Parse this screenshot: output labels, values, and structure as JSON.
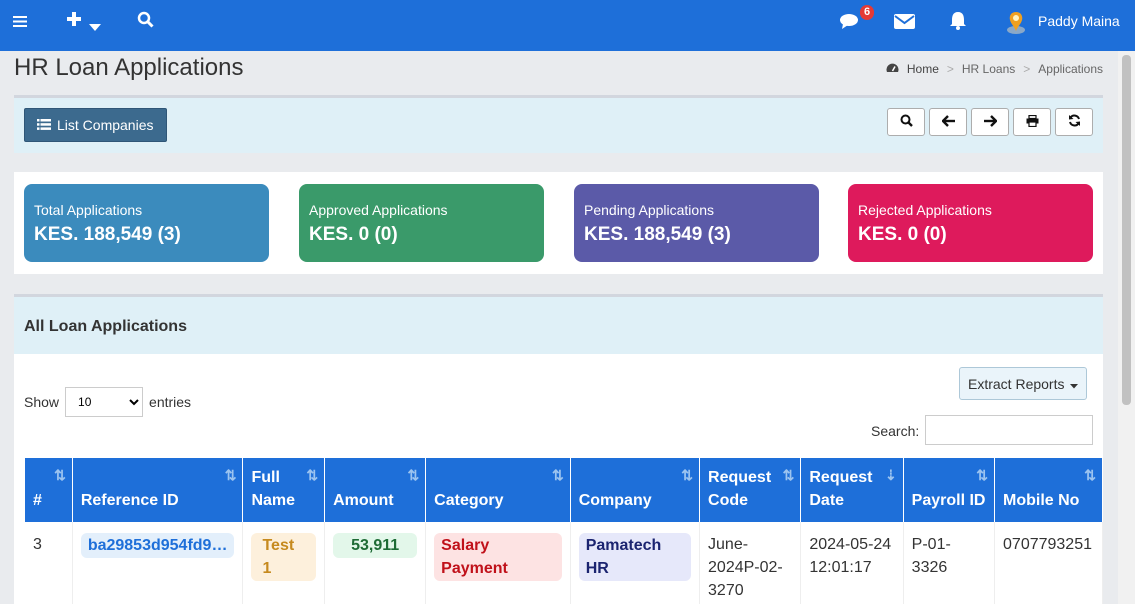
{
  "header": {
    "message_badge": "6",
    "user_name": "Paddy Maina",
    "icons": [
      "menu-icon",
      "plus-icon",
      "caret-down-icon",
      "search-icon",
      "comments-icon",
      "envelope-icon",
      "bell-icon",
      "user-avatar"
    ]
  },
  "page": {
    "title": "HR Loan Applications",
    "breadcrumb": [
      "Home",
      "HR Loans",
      "Applications"
    ]
  },
  "toolbar": {
    "list_companies": "List Companies",
    "tools": [
      "search-icon",
      "arrow-left-icon",
      "arrow-right-icon",
      "print-icon",
      "refresh-icon"
    ]
  },
  "stats": [
    {
      "label": "Total Applications",
      "value": "KES. 188,549 (3)",
      "color": "#3b8bbd"
    },
    {
      "label": "Approved Applications",
      "value": "KES. 0 (0)",
      "color": "#3a9a6a"
    },
    {
      "label": "Pending Applications",
      "value": "KES. 188,549 (3)",
      "color": "#5b5aa8"
    },
    {
      "label": "Rejected Applications",
      "value": "KES. 0 (0)",
      "color": "#de1a5c"
    }
  ],
  "table_panel": {
    "heading": "All Loan Applications",
    "show_label": "Show",
    "entries_label": "entries",
    "page_size": "10",
    "extract_label": "Extract Reports",
    "search_label": "Search:"
  },
  "table": {
    "columns": [
      "#",
      "Reference ID",
      "Full Name",
      "Amount",
      "Category",
      "Company",
      "Request Code",
      "Request Date",
      "Payroll ID",
      "Mobile No"
    ],
    "rows": [
      {
        "num": "3",
        "ref": "ba29853d954fd9…",
        "name": "Test 1",
        "amount": "53,911",
        "category": "Salary Payment",
        "company": "Pamatech HR",
        "request_code": "June-2024P-02-3270",
        "request_date": "2024-05-24 12:01:17",
        "payroll_id": "P-01-3326",
        "mobile": "0707793251"
      }
    ]
  }
}
